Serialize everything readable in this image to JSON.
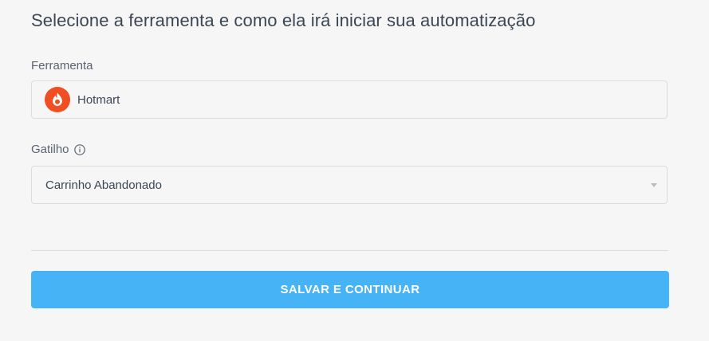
{
  "form": {
    "title": "Selecione a ferramenta e como ela irá iniciar sua automatização",
    "tool_label": "Ferramenta",
    "tool_value": "Hotmart",
    "tool_icon": "hotmart-logo-icon",
    "trigger_label": "Gatilho",
    "trigger_info_icon": "info-icon",
    "trigger_value": "Carrinho Abandonado",
    "trigger_dropdown_icon": "chevron-down-icon",
    "submit_label": "SALVAR E CONTINUAR"
  },
  "colors": {
    "background": "#f6f6f6",
    "text": "#3b4756",
    "label": "#5b6472",
    "border": "#dcdcdc",
    "button": "#45b3f5",
    "hotmart": "#f04e23"
  }
}
